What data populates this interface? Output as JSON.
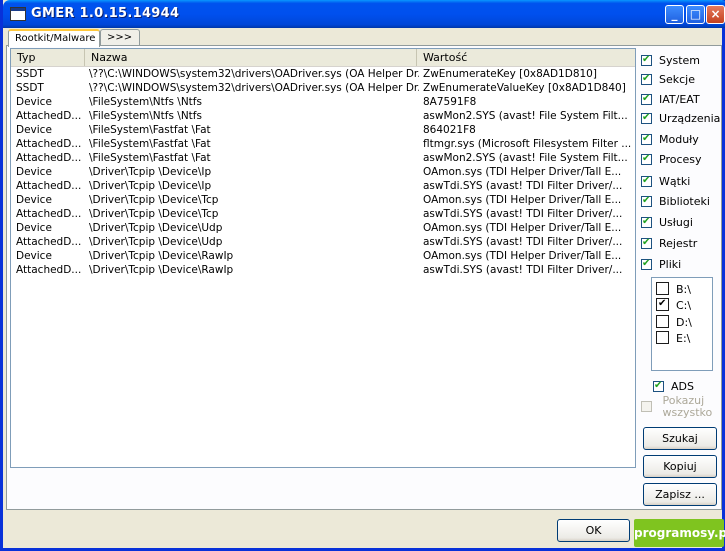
{
  "window": {
    "title": "GMER 1.0.15.14944"
  },
  "tabs": [
    {
      "label": "Rootkit/Malware"
    },
    {
      "label": ">>>"
    }
  ],
  "list": {
    "columns": [
      "Typ",
      "Nazwa",
      "Wartość"
    ],
    "rows": [
      [
        "SSDT",
        "\\??\\C:\\WINDOWS\\system32\\drivers\\OADriver.sys (OA Helper Dr...",
        "ZwEnumerateKey [0x8AD1D810]"
      ],
      [
        "SSDT",
        "\\??\\C:\\WINDOWS\\system32\\drivers\\OADriver.sys (OA Helper Dr...",
        "ZwEnumerateValueKey [0x8AD1D840]"
      ],
      [
        "Device",
        "\\FileSystem\\Ntfs \\Ntfs",
        "8A7591F8"
      ],
      [
        "AttachedD...",
        "\\FileSystem\\Ntfs \\Ntfs",
        "aswMon2.SYS (avast! File System Filt..."
      ],
      [
        "Device",
        "\\FileSystem\\Fastfat \\Fat",
        "864021F8"
      ],
      [
        "AttachedD...",
        "\\FileSystem\\Fastfat \\Fat",
        "fltmgr.sys (Microsoft Filesystem Filter ..."
      ],
      [
        "AttachedD...",
        "\\FileSystem\\Fastfat \\Fat",
        "aswMon2.SYS (avast! File System Filt..."
      ],
      [
        "Device",
        "\\Driver\\Tcpip \\Device\\Ip",
        "OAmon.sys (TDI Helper Driver/Tall E..."
      ],
      [
        "AttachedD...",
        "\\Driver\\Tcpip \\Device\\Ip",
        "aswTdi.SYS (avast! TDI Filter Driver/..."
      ],
      [
        "Device",
        "\\Driver\\Tcpip \\Device\\Tcp",
        "OAmon.sys (TDI Helper Driver/Tall E..."
      ],
      [
        "AttachedD...",
        "\\Driver\\Tcpip \\Device\\Tcp",
        "aswTdi.SYS (avast! TDI Filter Driver/..."
      ],
      [
        "Device",
        "\\Driver\\Tcpip \\Device\\Udp",
        "OAmon.sys (TDI Helper Driver/Tall E..."
      ],
      [
        "AttachedD...",
        "\\Driver\\Tcpip \\Device\\Udp",
        "aswTdi.SYS (avast! TDI Filter Driver/..."
      ],
      [
        "Device",
        "\\Driver\\Tcpip \\Device\\RawIp",
        "OAmon.sys (TDI Helper Driver/Tall E..."
      ],
      [
        "AttachedD...",
        "\\Driver\\Tcpip \\Device\\RawIp",
        "aswTdi.SYS (avast! TDI Filter Driver/..."
      ]
    ]
  },
  "options": [
    {
      "label": "System",
      "checked": true
    },
    {
      "label": "Sekcje",
      "checked": true
    },
    {
      "label": "IAT/EAT",
      "checked": true
    },
    {
      "label": "Urządzenia",
      "checked": true
    },
    {
      "label": "Moduły",
      "checked": true
    },
    {
      "label": "Procesy",
      "checked": true
    },
    {
      "label": "Wątki",
      "checked": true
    },
    {
      "label": "Biblioteki",
      "checked": true
    },
    {
      "label": "Usługi",
      "checked": true
    },
    {
      "label": "Rejestr",
      "checked": true
    },
    {
      "label": "Pliki",
      "checked": true
    }
  ],
  "drives": [
    {
      "label": "B:\\",
      "checked": false
    },
    {
      "label": "C:\\",
      "checked": true
    },
    {
      "label": "D:\\",
      "checked": false
    },
    {
      "label": "E:\\",
      "checked": false
    }
  ],
  "ads": {
    "label": "ADS",
    "checked": true
  },
  "show_all": {
    "label_line1": "Pokazuj",
    "label_line2": "wszystko",
    "checked": false
  },
  "buttons": {
    "scan": "Szukaj",
    "copy": "Kopiuj",
    "save": "Zapisz ...",
    "ok": "OK"
  },
  "watermark": "programosy.pl"
}
